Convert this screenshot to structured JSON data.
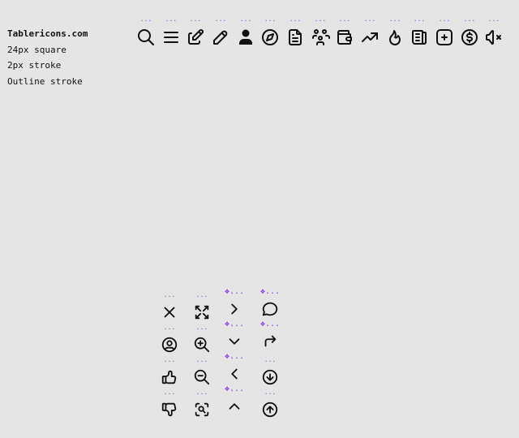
{
  "info": {
    "title": "Tablericons.com",
    "lines": [
      "24px square",
      "2px stroke",
      "Outline stroke"
    ]
  },
  "marker": "...",
  "marker_special": "❖...",
  "accent": "#6b4fd8",
  "top_icons": [
    "search-icon",
    "menu-icon",
    "edit-icon",
    "pencil-icon",
    "user-icon",
    "compass-icon",
    "file-text-icon",
    "users-icon",
    "wallet-icon",
    "trending-up-icon",
    "flame-icon",
    "news-icon",
    "square-plus-icon",
    "currency-dollar-icon",
    "volume-mute-icon"
  ],
  "grid_icons": [
    [
      "x-icon",
      "arrows-maximize-icon",
      "chevron-right-icon",
      "message-circle-icon"
    ],
    [
      "user-circle-icon",
      "zoom-in-icon",
      "chevron-down-icon",
      "corner-up-right-icon"
    ],
    [
      "thumb-up-icon",
      "zoom-out-icon",
      "chevron-left-icon",
      "circle-arrow-down-icon"
    ],
    [
      "thumb-down-icon",
      "zoom-scan-icon",
      "chevron-up-icon",
      "circle-arrow-up-icon"
    ]
  ]
}
